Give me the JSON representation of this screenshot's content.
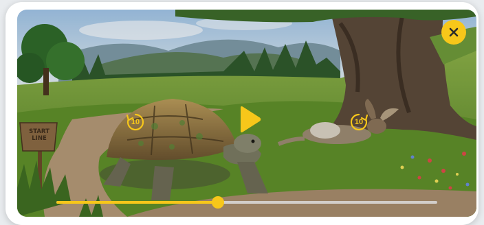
{
  "player": {
    "state": "paused",
    "progress": 0.424,
    "seek_back_seconds": "10",
    "seek_forward_seconds": "10",
    "accent_color": "#f7c71a"
  },
  "scene": {
    "sign_line1": "START",
    "sign_line2": "LINE"
  },
  "icons": {
    "close": "close-icon",
    "play": "play-icon",
    "rewind": "replay-10-icon",
    "forward": "forward-10-icon"
  }
}
